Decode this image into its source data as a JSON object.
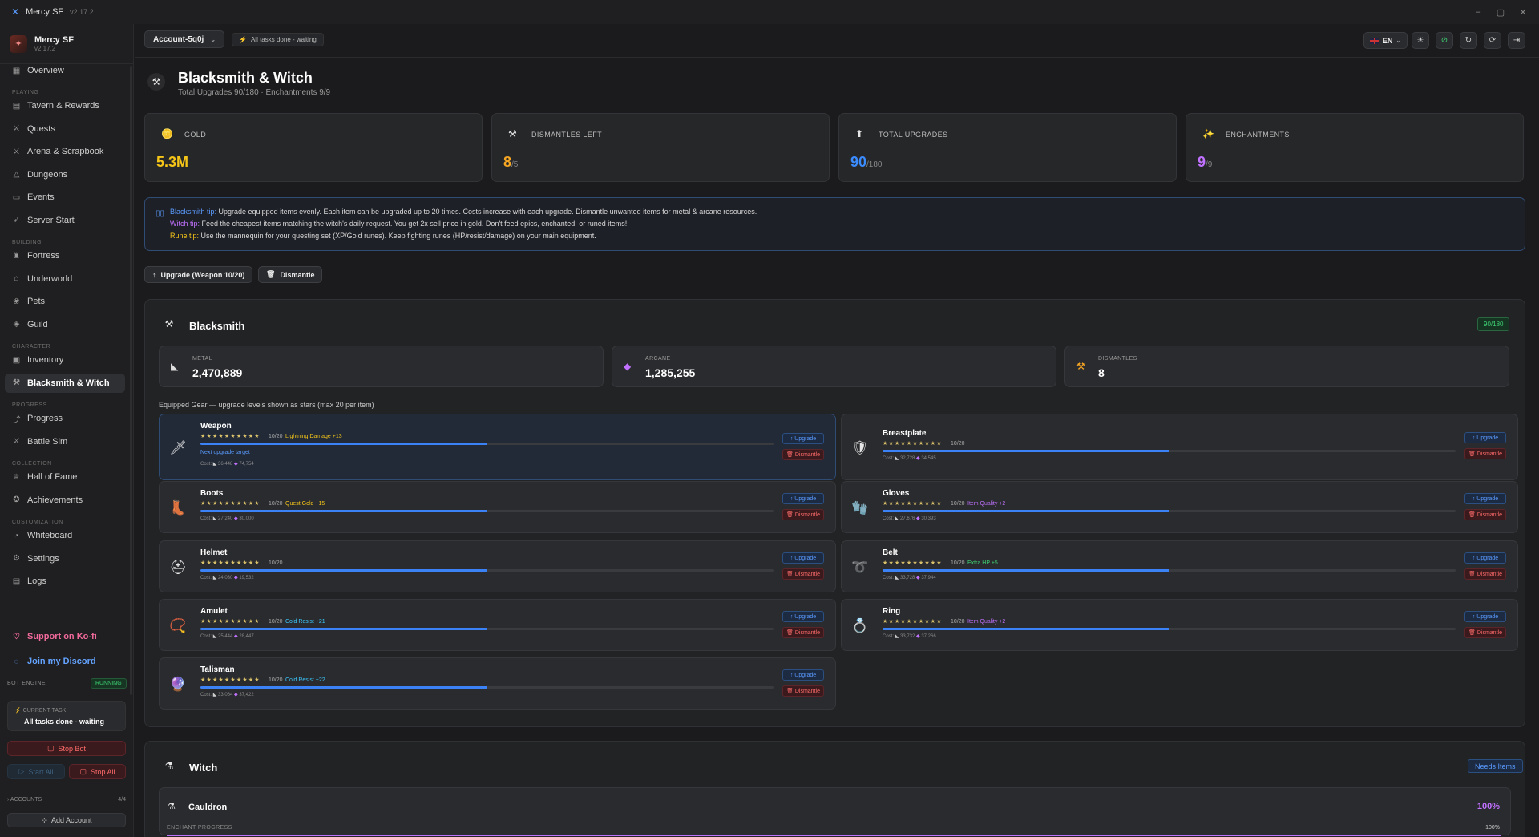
{
  "app": {
    "title": "Mercy SF",
    "version": "v2.17.2"
  },
  "window_controls": {
    "minimize": "–",
    "maximize": "▢",
    "close": "✕"
  },
  "sidebar": {
    "brand_name": "Mercy SF",
    "brand_version": "v2.17.2",
    "items": [
      {
        "label": "Overview",
        "icon": "grid-icon"
      },
      {
        "section": "PLAYING"
      },
      {
        "label": "Tavern & Rewards",
        "icon": "building-icon"
      },
      {
        "label": "Quests",
        "icon": "swords-icon"
      },
      {
        "label": "Arena & Scrapbook",
        "icon": "swords-icon"
      },
      {
        "label": "Dungeons",
        "icon": "mountain-icon"
      },
      {
        "label": "Events",
        "icon": "calendar-icon"
      },
      {
        "label": "Server Start",
        "icon": "rocket-icon"
      },
      {
        "section": "BUILDING"
      },
      {
        "label": "Fortress",
        "icon": "castle-icon"
      },
      {
        "label": "Underworld",
        "icon": "home-icon"
      },
      {
        "label": "Pets",
        "icon": "paw-icon"
      },
      {
        "label": "Guild",
        "icon": "shield-icon"
      },
      {
        "section": "CHARACTER"
      },
      {
        "label": "Inventory",
        "icon": "box-icon"
      },
      {
        "label": "Blacksmith & Witch",
        "icon": "hammer-icon",
        "active": true
      },
      {
        "section": "PROGRESS"
      },
      {
        "label": "Progress",
        "icon": "trend-icon"
      },
      {
        "label": "Battle Sim",
        "icon": "swords-icon"
      },
      {
        "section": "COLLECTION"
      },
      {
        "label": "Hall of Fame",
        "icon": "trophy-icon"
      },
      {
        "label": "Achievements",
        "icon": "award-icon"
      },
      {
        "section": "CUSTOMIZATION"
      },
      {
        "label": "Whiteboard",
        "icon": "palette-icon"
      },
      {
        "label": "Settings",
        "icon": "gear-icon"
      },
      {
        "label": "Logs",
        "icon": "file-icon"
      }
    ],
    "support_label": "Support on Ko-fi",
    "discord_label": "Join my Discord"
  },
  "bot": {
    "engine_label": "BOT ENGINE",
    "status": "RUNNING",
    "current_task_label": "CURRENT TASK",
    "current_task": "All tasks done - waiting",
    "stop_bot": "Stop Bot",
    "start_all": "Start All",
    "stop_all": "Stop All",
    "accounts_label": "ACCOUNTS",
    "accounts_count": "4/4",
    "add_account": "Add Account"
  },
  "header": {
    "account": "Account-5q0j",
    "status": "All tasks done - waiting",
    "language": "EN"
  },
  "page": {
    "title": "Blacksmith & Witch",
    "subtitle": "Total Upgrades 90/180 · Enchantments 9/9"
  },
  "stats": [
    {
      "label": "GOLD",
      "value": "5.3M",
      "max": "",
      "color": "#f5c518",
      "icon": "gold-coin-icon"
    },
    {
      "label": "DISMANTLES LEFT",
      "value": "8",
      "max": "/5",
      "color": "#f5a623",
      "icon": "anvil-icon"
    },
    {
      "label": "TOTAL UPGRADES",
      "value": "90",
      "max": "/180",
      "color": "#3b8cff",
      "icon": "arrow-up-icon"
    },
    {
      "label": "ENCHANTMENTS",
      "value": "9",
      "max": "/9",
      "color": "#c071ff",
      "icon": "sparkle-icon"
    }
  ],
  "tips": {
    "blacksmith_label": "Blacksmith tip:",
    "blacksmith_text": " Upgrade equipped items evenly. Each item can be upgraded up to 20 times. Costs increase with each upgrade. Dismantle unwanted items for metal & arcane resources.",
    "witch_label": "Witch tip:",
    "witch_text": " Feed the cheapest items matching the witch's daily request. You get 2x sell price in gold. Don't feed epics, enchanted, or runed items!",
    "rune_label": "Rune tip:",
    "rune_text": " Use the mannequin for your questing set (XP/Gold runes). Keep fighting runes (HP/resist/damage) on your main equipment."
  },
  "actions": {
    "upgrade": "Upgrade (Weapon 10/20)",
    "dismantle": "Dismantle"
  },
  "blacksmith": {
    "title": "Blacksmith",
    "badge": "90/180",
    "resources": [
      {
        "label": "METAL",
        "value": "2,470,889",
        "icon": "metal-icon"
      },
      {
        "label": "ARCANE",
        "value": "1,285,255",
        "icon": "crystal-icon"
      },
      {
        "label": "DISMANTLES",
        "value": "8",
        "icon": "anvil-icon"
      }
    ],
    "gear_caption": "Equipped Gear — upgrade levels shown as stars (max 20 per item)",
    "upgrade_label": "↑ Upgrade",
    "dismantle_label": "🗑 Dismantle",
    "cost_label": "Cost:",
    "next_target": "Next upgrade target",
    "items": [
      {
        "name": "Weapon",
        "stars": "★★★★★★★★★★",
        "level": "10/20",
        "upgrade_fraction": 0.5,
        "bonus": "Lightning Damage +13",
        "bonus_color": "#f5c518",
        "cost_metal": "36,448",
        "cost_arcane": "74,754",
        "selected": true,
        "icon": "weapon-icon"
      },
      {
        "name": "Breastplate",
        "stars": "★★★★★★★★★★",
        "level": "10/20",
        "upgrade_fraction": 0.5,
        "bonus": "",
        "bonus_color": "#aaa",
        "cost_metal": "32,728",
        "cost_arcane": "34,545",
        "icon": "armor-icon"
      },
      {
        "name": "Boots",
        "stars": "★★★★★★★★★★",
        "level": "10/20",
        "upgrade_fraction": 0.5,
        "bonus": "Quest Gold +15",
        "bonus_color": "#f5c518",
        "cost_metal": "27,240",
        "cost_arcane": "30,000",
        "icon": "boots-icon"
      },
      {
        "name": "Gloves",
        "stars": "★★★★★★★★★★",
        "level": "10/20",
        "upgrade_fraction": 0.5,
        "bonus": "Item Quality +2",
        "bonus_color": "#c071ff",
        "cost_metal": "27,676",
        "cost_arcane": "30,393",
        "icon": "gloves-icon"
      },
      {
        "name": "Helmet",
        "stars": "★★★★★★★★★★",
        "level": "10/20",
        "upgrade_fraction": 0.5,
        "bonus": "",
        "bonus_color": "#aaa",
        "cost_metal": "24,030",
        "cost_arcane": "19,532",
        "icon": "helmet-icon"
      },
      {
        "name": "Belt",
        "stars": "★★★★★★★★★★",
        "level": "10/20",
        "upgrade_fraction": 0.5,
        "bonus": "Extra HP +5",
        "bonus_color": "#3fd174",
        "cost_metal": "33,728",
        "cost_arcane": "37,944",
        "icon": "belt-icon"
      },
      {
        "name": "Amulet",
        "stars": "★★★★★★★★★★",
        "level": "10/20",
        "upgrade_fraction": 0.5,
        "bonus": "Cold Resist +21",
        "bonus_color": "#3bc8ff",
        "cost_metal": "25,444",
        "cost_arcane": "28,447",
        "icon": "amulet-icon"
      },
      {
        "name": "Ring",
        "stars": "★★★★★★★★★★",
        "level": "10/20",
        "upgrade_fraction": 0.5,
        "bonus": "Item Quality +2",
        "bonus_color": "#c071ff",
        "cost_metal": "33,732",
        "cost_arcane": "37,266",
        "icon": "ring-icon"
      },
      {
        "name": "Talisman",
        "stars": "★★★★★★★★★★",
        "level": "10/20",
        "upgrade_fraction": 0.5,
        "bonus": "Cold Resist +22",
        "bonus_color": "#3bc8ff",
        "cost_metal": "33,064",
        "cost_arcane": "37,422",
        "icon": "talisman-icon"
      }
    ]
  },
  "witch": {
    "title": "Witch",
    "badge": "Needs Items",
    "cauldron": "Cauldron",
    "percent": "100%",
    "progress_label": "ENCHANT PROGRESS",
    "progress_value": "100%",
    "progress_fraction": 1.0
  }
}
